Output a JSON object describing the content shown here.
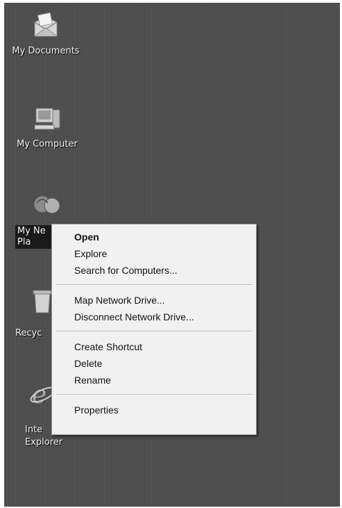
{
  "desktop": {
    "icons": [
      {
        "label": "My Documents",
        "icon": "my-documents-icon"
      },
      {
        "label": "My Computer",
        "icon": "my-computer-icon"
      },
      {
        "label": "My Network\nPlaces",
        "icon": "my-network-places-icon",
        "visible_label": "My Ne\nPla"
      },
      {
        "label": "Recycle Bin",
        "icon": "recycle-bin-icon",
        "visible_label": "Recyc"
      },
      {
        "label": "Internet\nExplorer",
        "icon": "internet-explorer-icon",
        "visible_label": "Inte\nExplorer"
      }
    ]
  },
  "context_menu": {
    "items": [
      {
        "label": "Open",
        "bold": true
      },
      {
        "label": "Explore"
      },
      {
        "label": "Search for Computers..."
      },
      {
        "label": "Map Network Drive..."
      },
      {
        "label": "Disconnect Network Drive..."
      },
      {
        "label": "Create Shortcut"
      },
      {
        "label": "Delete"
      },
      {
        "label": "Rename"
      },
      {
        "label": "Properties"
      }
    ]
  },
  "colors": {
    "desktop_bg": "#4e4e4e",
    "menu_bg": "#f1f1f1",
    "menu_text": "#111111"
  }
}
